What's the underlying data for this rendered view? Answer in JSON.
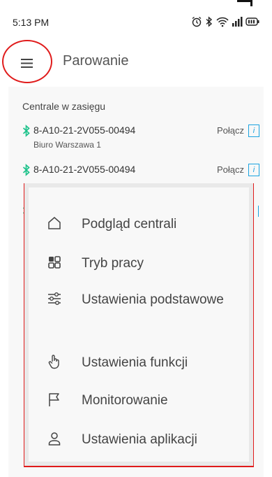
{
  "status_bar": {
    "time": "5:13 PM"
  },
  "app_bar": {
    "title": "Parowanie"
  },
  "section": {
    "title": "Centrale w zasięgu"
  },
  "devices": [
    {
      "id": "8-A10-21-2V055-00494",
      "name": "Biuro Warszawa 1",
      "action": "Połącz"
    },
    {
      "id": "8-A10-21-2V055-00494",
      "name": "",
      "action": "Połącz"
    }
  ],
  "menu": {
    "items": [
      {
        "label": "Podgląd centrali",
        "icon": "home-icon"
      },
      {
        "label": "Tryb pracy",
        "icon": "grid-icon"
      },
      {
        "label": "Ustawienia podstawowe",
        "icon": "sliders-icon"
      },
      {
        "label": "Ustawienia funkcji",
        "icon": "hand-pointer-icon"
      },
      {
        "label": "Monitorowanie",
        "icon": "flag-icon"
      },
      {
        "label": "Ustawienia aplikacji",
        "icon": "user-icon"
      }
    ]
  },
  "colors": {
    "bluetooth": "#1ec28b",
    "info": "#1aa3e0",
    "highlight": "#e01b1b"
  }
}
